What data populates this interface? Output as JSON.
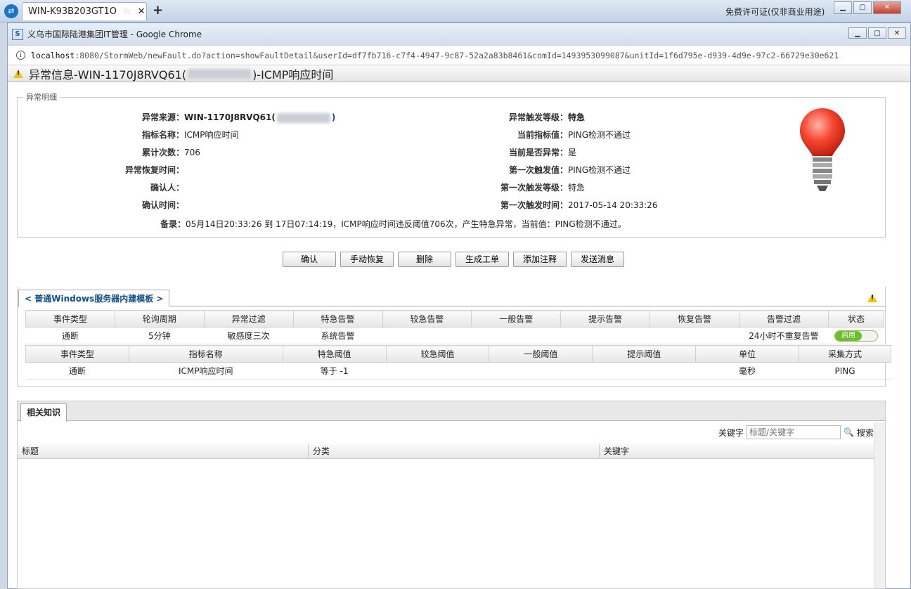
{
  "outer": {
    "tab_title": "WIN-K93B203GT1O",
    "license": "免费许可证(仅非商业用途)"
  },
  "browser": {
    "title": "义乌市国际陆港集团IT管理 - Google Chrome",
    "url_host": "localhost",
    "url_rest": ":8080/StormWeb/newFault.do?action=showFaultDetail&userId=df7fb716-c7f4-4947-9c87-52a2a83b8461&comId=1493953099087&unitId=1f6d795e-d939-4d9e-97c2-66729e30e621"
  },
  "page": {
    "title_prefix": "异常信息-WIN-1170J8RVQ61(",
    "title_suffix": ")-ICMP响应时间",
    "legend": "异常明细",
    "details_left": [
      {
        "k": "异常来源：",
        "v": "WIN-1170J8RVQ61("
      },
      {
        "k": "指标名称：",
        "v": "ICMP响应时间"
      },
      {
        "k": "累计次数：",
        "v": "706"
      },
      {
        "k": "异常恢复时间：",
        "v": ""
      },
      {
        "k": "确认人：",
        "v": ""
      },
      {
        "k": "确认时间：",
        "v": ""
      }
    ],
    "details_right": [
      {
        "k": "异常触发等级：",
        "v": "特急"
      },
      {
        "k": "当前指标值：",
        "v": "PING检测不通过"
      },
      {
        "k": "当前是否异常：",
        "v": "是"
      },
      {
        "k": "第一次触发值：",
        "v": "PING检测不通过"
      },
      {
        "k": "第一次触发等级：",
        "v": "特急"
      },
      {
        "k": "第一次触发时间：",
        "v": "2017-05-14 20:33:26"
      }
    ],
    "remark_label": "备录：",
    "remark_value": "05月14日20:33:26 到 17日07:14:19，ICMP响应时间违反阈值706次，产生特急异常，当前值：PING检测不通过。",
    "buttons": [
      "确认",
      "手动恢复",
      "删除",
      "生成工单",
      "添加注释",
      "发送消息"
    ]
  },
  "template": {
    "tab_label": "< 普通Windows服务器内建模板 >",
    "t1_headers": [
      "事件类型",
      "轮询周期",
      "异常过滤",
      "特急告警",
      "较急告警",
      "一般告警",
      "提示告警",
      "恢复告警",
      "告警过滤",
      "状态"
    ],
    "t1_row": [
      "通断",
      "5分钟",
      "敏感度三次",
      "系统告警",
      "",
      "",
      "",
      "",
      "24小时不重复告警",
      ""
    ],
    "toggle": "启用",
    "t2_headers": [
      "事件类型",
      "指标名称",
      "特急阈值",
      "较急阈值",
      "一般阈值",
      "提示阈值",
      "单位",
      "采集方式"
    ],
    "t2_row": [
      "通断",
      "ICMP响应时间",
      "等于 -1",
      "",
      "",
      "",
      "毫秒",
      "PING"
    ]
  },
  "knowledge": {
    "tab": "相关知识",
    "keyword_label": "关键字",
    "keyword_placeholder": "标题/关键字",
    "search_btn": "搜索",
    "cols": [
      "标题",
      "分类",
      "关键字"
    ]
  }
}
